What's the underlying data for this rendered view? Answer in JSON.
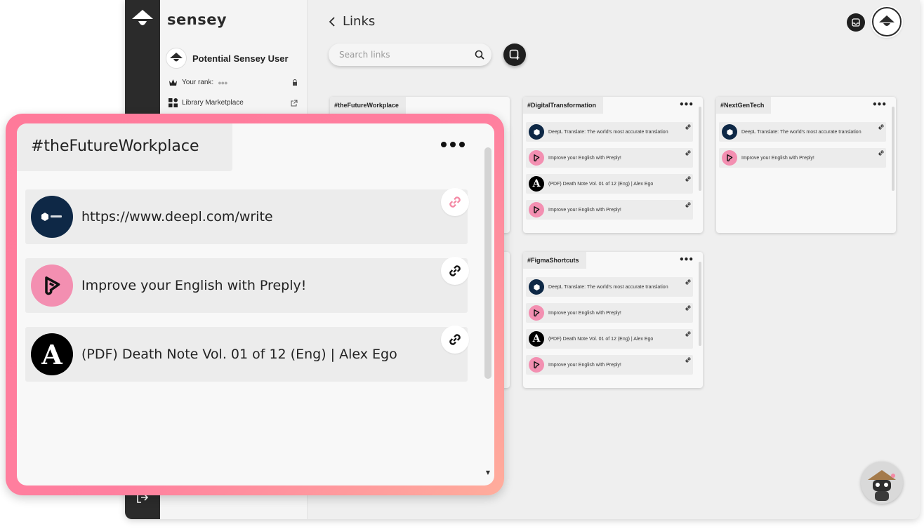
{
  "app": {
    "brand": "sensey",
    "user_name": "Potential Sensey User",
    "rank_label": "Your rank:",
    "rank_value": "●●●",
    "library_label": "Library Marketplace"
  },
  "main": {
    "title": "Links",
    "search_placeholder": "Search links"
  },
  "cards": [
    {
      "tag": "#theFutureWorkplace",
      "items": []
    },
    {
      "tag": "#DigitalTransformation",
      "items": [
        {
          "icon": "deepl-icon",
          "title": "DeepL Translate: The world's most accurate translation"
        },
        {
          "icon": "preply-icon",
          "title": "Improve your English with Preply!"
        },
        {
          "icon": "alex-icon",
          "title": "(PDF) Death Note Vol. 01 of 12 (Eng) | Alex Ego"
        },
        {
          "icon": "preply-icon",
          "title": "Improve your English with Preply!"
        }
      ]
    },
    {
      "tag": "#NextGenTech",
      "items": [
        {
          "icon": "deepl-icon",
          "title": "DeepL Translate: The world's most accurate translation"
        },
        {
          "icon": "preply-icon",
          "title": "Improve your English with Preply!"
        }
      ]
    },
    {
      "tag": "#FigmaShortcuts",
      "items": [
        {
          "icon": "deepl-icon",
          "title": "DeepL Translate: The world's most accurate translation"
        },
        {
          "icon": "preply-icon",
          "title": "Improve your English with Preply!"
        },
        {
          "icon": "alex-icon",
          "title": "(PDF) Death Note Vol. 01 of 12 (Eng) | Alex Ego"
        },
        {
          "icon": "preply-icon",
          "title": "Improve your English with Preply!"
        }
      ]
    }
  ],
  "overlay": {
    "tag": "#theFutureWorkplace",
    "items": [
      {
        "icon": "deepl-icon",
        "title": "https://www.deepl.com/write",
        "link_color": "#f48aa5"
      },
      {
        "icon": "preply-icon",
        "title": "Improve your English with Preply!",
        "link_color": "#111111"
      },
      {
        "icon": "alex-icon",
        "title": "(PDF) Death Note Vol. 01 of 12 (Eng) | Alex Ego",
        "link_color": "#111111"
      }
    ]
  },
  "colors": {
    "accent_gradient_start": "#ff7a9a",
    "accent_gradient_end": "#ffad9c",
    "deepl_blue": "#0e2846",
    "preply_pink": "#f38fb1",
    "rail_dark": "#2b2b2b"
  }
}
